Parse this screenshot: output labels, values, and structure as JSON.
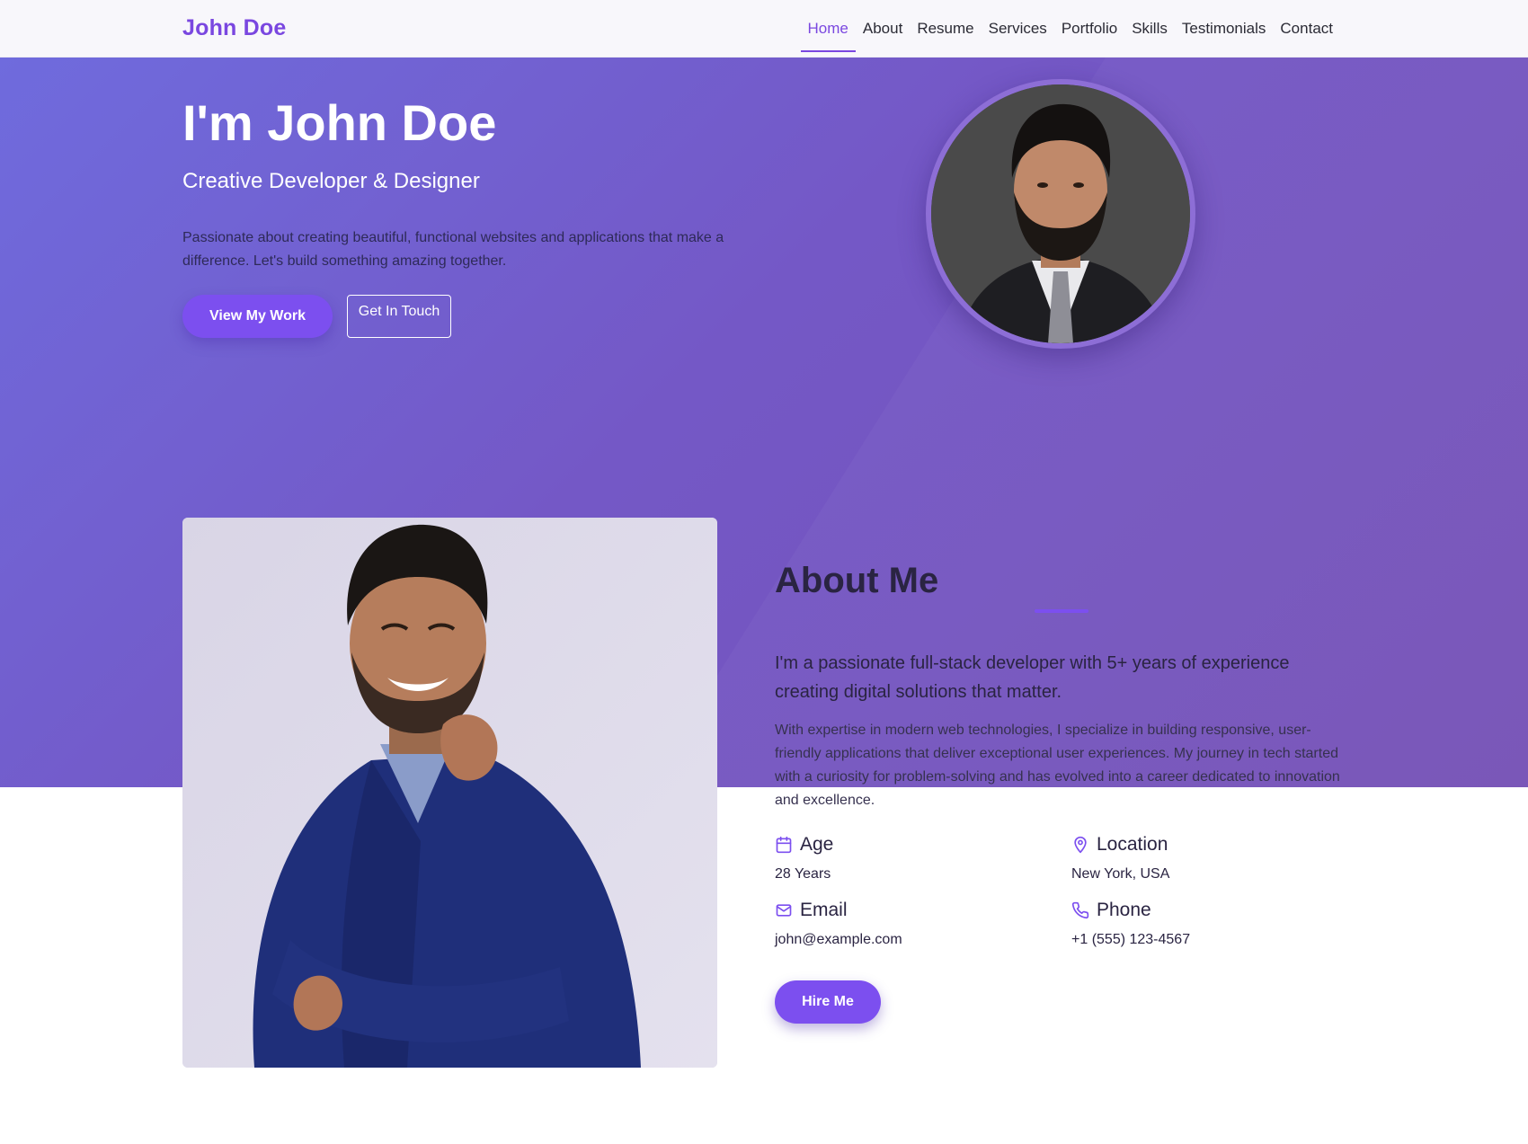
{
  "brand": "John Doe",
  "nav": {
    "items": [
      {
        "label": "Home",
        "active": true
      },
      {
        "label": "About"
      },
      {
        "label": "Resume"
      },
      {
        "label": "Services"
      },
      {
        "label": "Portfolio"
      },
      {
        "label": "Skills"
      },
      {
        "label": "Testimonials"
      },
      {
        "label": "Contact"
      }
    ]
  },
  "hero": {
    "title": "I'm John Doe",
    "subtitle": "Creative Developer & Designer",
    "description": "Passionate about creating beautiful, functional websites and applications that make a difference. Let's build something amazing together.",
    "primary_button": "View My Work",
    "secondary_button": "Get In Touch"
  },
  "about": {
    "title": "About Me",
    "lead": "I'm a passionate full-stack developer with 5+ years of experience creating digital solutions that matter.",
    "body": "With expertise in modern web technologies, I specialize in building responsive, user-friendly applications that deliver exceptional user experiences. My journey in tech started with a curiosity for problem-solving and has evolved into a career dedicated to innovation and excellence.",
    "info": [
      {
        "label": "Age",
        "value": "28 Years",
        "icon": "calendar-icon"
      },
      {
        "label": "Location",
        "value": "New York, USA",
        "icon": "map-pin-icon"
      },
      {
        "label": "Email",
        "value": "john@example.com",
        "icon": "mail-icon"
      },
      {
        "label": "Phone",
        "value": "+1 (555) 123-4567",
        "icon": "phone-icon"
      }
    ],
    "hire_button": "Hire Me"
  },
  "colors": {
    "accent": "#7c4fef",
    "brand": "#7a47e0",
    "hero_gradient_start": "#6f6bdd",
    "hero_gradient_end": "#7651b6"
  }
}
